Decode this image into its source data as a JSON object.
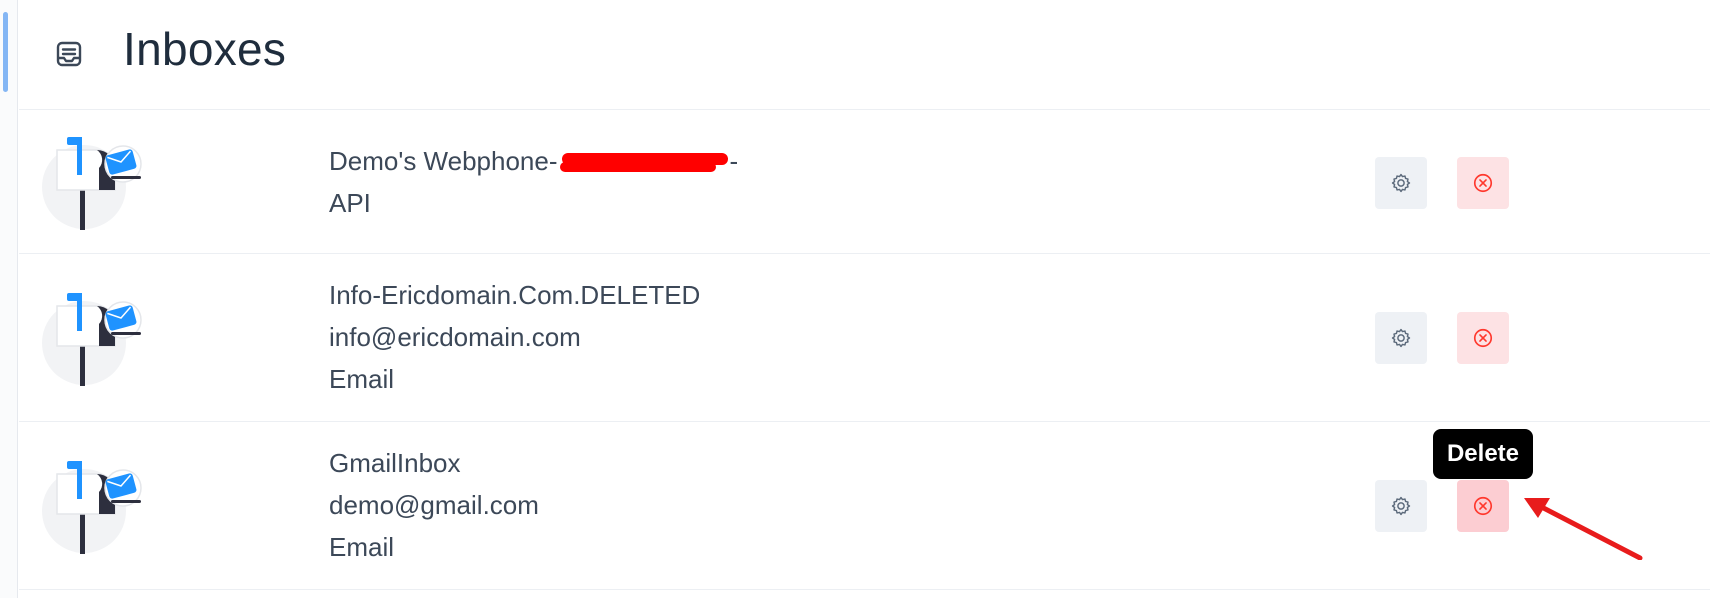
{
  "header": {
    "title": "Inboxes",
    "icon": "inbox-icon"
  },
  "inboxes": [
    {
      "name_prefix": "Demo's Webphone-",
      "name_suffix": "-",
      "channel": "API",
      "settings_icon": "gear-icon",
      "delete_icon": "circle-x-icon"
    },
    {
      "name": "Info-Ericdomain.Com.DELETED",
      "email": "info@ericdomain.com",
      "channel": "Email",
      "settings_icon": "gear-icon",
      "delete_icon": "circle-x-icon"
    },
    {
      "name": "GmailInbox",
      "email": "demo@gmail.com",
      "channel": "Email",
      "settings_icon": "gear-icon",
      "delete_icon": "circle-x-icon"
    }
  ],
  "tooltip": {
    "label": "Delete"
  },
  "colors": {
    "accent": "#1f93ff",
    "delete_red": "#ff382d",
    "annotation_red": "#e81c1c",
    "redaction": "#ff0000"
  }
}
